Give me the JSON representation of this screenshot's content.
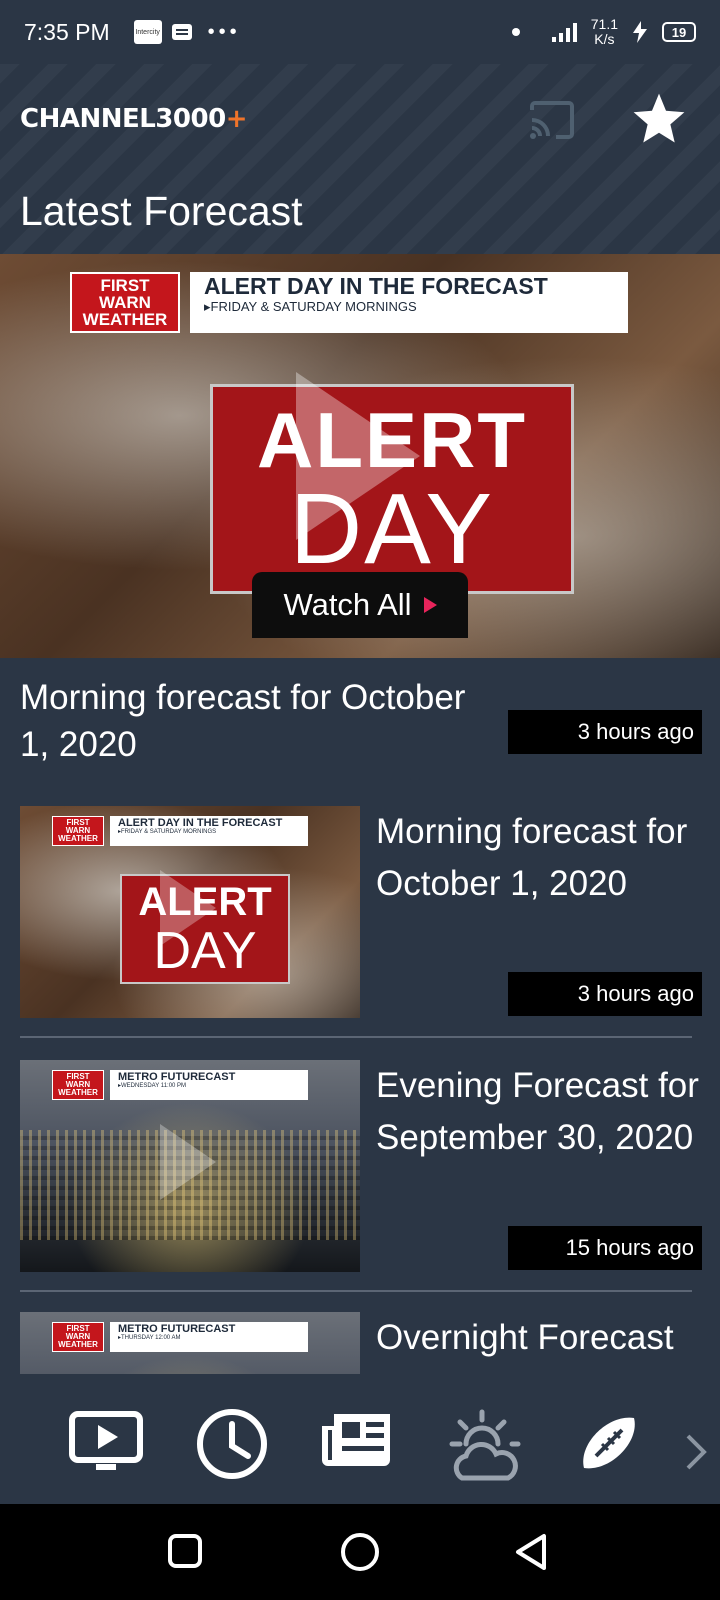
{
  "status_bar": {
    "time": "7:35 PM",
    "notif_label": "Intercity",
    "speed_top": "71.1",
    "speed_bottom": "K/s",
    "battery": "19"
  },
  "header": {
    "logo_text": "CHANNEL3000",
    "logo_plus": "+",
    "page_title": "Latest Forecast"
  },
  "hero": {
    "banner_brand": "FIRST WARN WEATHER",
    "banner_title": "ALERT DAY IN THE FORECAST",
    "banner_subtitle": "▸FRIDAY & SATURDAY MORNINGS",
    "graphic_line1": "ALERT",
    "graphic_line2": "DAY",
    "watch_all_label": "Watch All"
  },
  "featured": {
    "title": "Morning forecast for October 1, 2020",
    "time": "3 hours ago"
  },
  "videos": [
    {
      "title": "Morning forecast for October 1, 2020",
      "time": "3 hours ago",
      "thumb_brand": "FIRST WARN WEATHER",
      "thumb_title": "ALERT DAY IN THE FORECAST",
      "thumb_subtitle": "▸FRIDAY & SATURDAY MORNINGS",
      "thumb_line1": "ALERT",
      "thumb_line2": "DAY"
    },
    {
      "title": "Evening Forecast for September 30, 2020",
      "time": "15 hours ago",
      "thumb_brand": "FIRST WARN WEATHER",
      "thumb_title": "METRO FUTURECAST",
      "thumb_subtitle": "▸WEDNESDAY 11:00 PM"
    },
    {
      "title": "Overnight Forecast",
      "thumb_brand": "FIRST WARN WEATHER",
      "thumb_title": "METRO FUTURECAST",
      "thumb_subtitle": "▸THURSDAY 12:00 AM"
    }
  ],
  "bottom_nav": {
    "items": [
      "video-icon",
      "clock-icon",
      "news-icon",
      "weather-icon",
      "football-icon",
      "chevron-right-icon"
    ]
  },
  "colors": {
    "background": "#2b3645",
    "accent_orange": "#f0742a",
    "watch_all_arrow": "#e8245b",
    "alert_red": "#a31519"
  }
}
